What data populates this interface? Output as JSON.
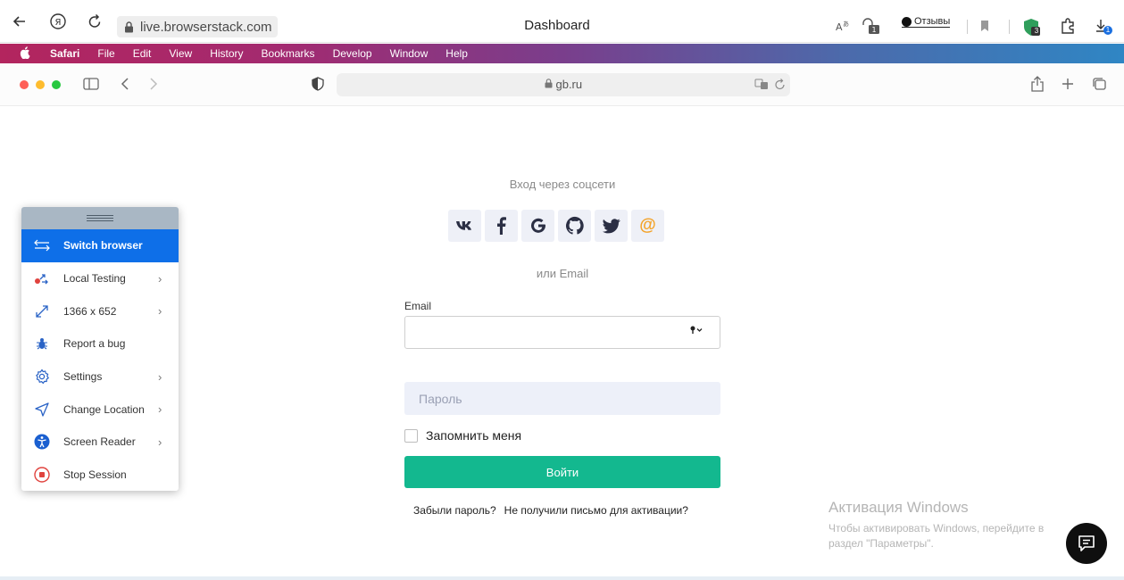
{
  "outer_browser": {
    "url": "live.browserstack.com",
    "title": "Dashboard",
    "feedback_label": "Отзывы",
    "extension_badge": "3",
    "download_badge": "1"
  },
  "mac_menu": {
    "items": [
      "Safari",
      "File",
      "Edit",
      "View",
      "History",
      "Bookmarks",
      "Develop",
      "Window",
      "Help"
    ]
  },
  "safari": {
    "url": "gb.ru"
  },
  "login": {
    "social_title": "Вход через соцсети",
    "social": [
      {
        "icon": "vk-icon",
        "glyph": "ʋк"
      },
      {
        "icon": "facebook-icon",
        "glyph": "f"
      },
      {
        "icon": "google-icon",
        "glyph": "G"
      },
      {
        "icon": "github-icon",
        "glyph": "⬤"
      },
      {
        "icon": "twitter-icon",
        "glyph": "🐦"
      },
      {
        "icon": "mail-icon",
        "glyph": "@"
      }
    ],
    "or_email": "или Email",
    "email_label": "Email",
    "email_value": "",
    "password_placeholder": "Пароль",
    "remember_label": "Запомнить меня",
    "submit_label": "Войти",
    "forgot_link": "Забыли пароль?",
    "resend_link": "Не получили письмо для активации?"
  },
  "windows_activation": {
    "title": "Активация Windows",
    "line1": "Чтобы активировать Windows, перейдите в",
    "line2": "раздел \"Параметры\"."
  },
  "bs_panel": {
    "items": [
      {
        "label": "Switch browser",
        "icon": "switch-browser-icon",
        "active": true,
        "submenu": false
      },
      {
        "label": "Local Testing",
        "icon": "local-testing-icon",
        "active": false,
        "submenu": true
      },
      {
        "label": "1366 x 652",
        "icon": "resolution-icon",
        "active": false,
        "submenu": true
      },
      {
        "label": "Report a bug",
        "icon": "bug-icon",
        "active": false,
        "submenu": false
      },
      {
        "label": "Settings",
        "icon": "gear-icon",
        "active": false,
        "submenu": true
      },
      {
        "label": "Change Location",
        "icon": "location-arrow-icon",
        "active": false,
        "submenu": true
      },
      {
        "label": "Screen Reader",
        "icon": "accessibility-icon",
        "active": false,
        "submenu": true
      },
      {
        "label": "Stop Session",
        "icon": "stop-icon",
        "active": false,
        "submenu": false
      }
    ]
  },
  "colors": {
    "accent_green": "#13b88f",
    "bs_blue": "#0e6fe8",
    "input_bg": "#edf0f9"
  }
}
